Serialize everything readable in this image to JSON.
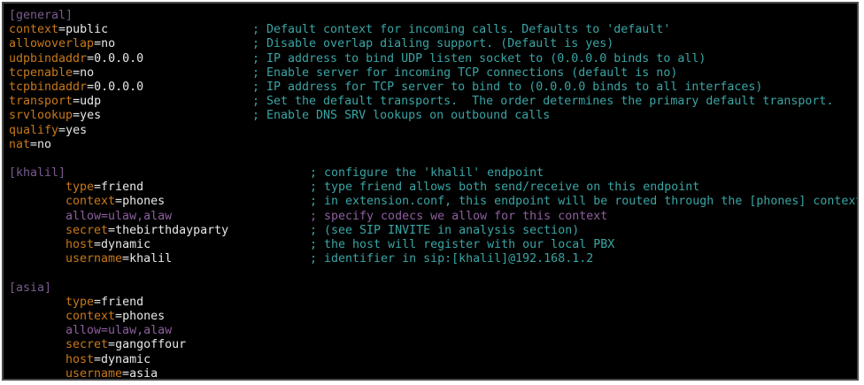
{
  "colors": {
    "background": "#000000",
    "section": "#7a5c8e",
    "key": "#c8781a",
    "value": "#e8e8e8",
    "comment": "#3aa5a5",
    "allow_line": "#8e5ea0"
  },
  "lines": [
    {
      "kind": "section",
      "text": "[general]"
    },
    {
      "kind": "kv",
      "key": "context",
      "eq": "=",
      "value": "public",
      "comment": "; Default context for incoming calls. Defaults to 'default'"
    },
    {
      "kind": "kv",
      "key": "allowoverlap",
      "eq": "=",
      "value": "no",
      "comment": "; Disable overlap dialing support. (Default is yes)"
    },
    {
      "kind": "kv",
      "key": "udpbindaddr",
      "eq": "=",
      "value": "0.0.0.0",
      "comment": "; IP address to bind UDP listen socket to (0.0.0.0 binds to all)"
    },
    {
      "kind": "kv",
      "key": "tcpenable",
      "eq": "=",
      "value": "no",
      "comment": "; Enable server for incoming TCP connections (default is no)"
    },
    {
      "kind": "kv",
      "key": "tcpbindaddr",
      "eq": "=",
      "value": "0.0.0.0",
      "comment": "; IP address for TCP server to bind to (0.0.0.0 binds to all interfaces)"
    },
    {
      "kind": "kv",
      "key": "transport",
      "eq": "=",
      "value": "udp",
      "comment": "; Set the default transports.  The order determines the primary default transport."
    },
    {
      "kind": "kv",
      "key": "srvlookup",
      "eq": "=",
      "value": "yes",
      "comment": "; Enable DNS SRV lookups on outbound calls"
    },
    {
      "kind": "kv",
      "key": "qualify",
      "eq": "=",
      "value": "yes",
      "comment": ""
    },
    {
      "kind": "kv",
      "key": "nat",
      "eq": "=",
      "value": "no",
      "comment": ""
    },
    {
      "kind": "blank"
    },
    {
      "kind": "section",
      "text": "[khalil]",
      "comment": "; configure the 'khalil' endpoint"
    },
    {
      "kind": "kv",
      "indent": true,
      "key": "type",
      "eq": "=",
      "value": "friend",
      "comment": "; type friend allows both send/receive on this endpoint"
    },
    {
      "kind": "kv",
      "indent": true,
      "key": "context",
      "eq": "=",
      "value": "phones",
      "comment": "; in extension.conf, this endpoint will be routed through the [phones] context"
    },
    {
      "kind": "kv",
      "indent": true,
      "purple": true,
      "key": "allow",
      "eq": "=",
      "value": "ulaw,alaw",
      "comment": "; specify codecs we allow for this context"
    },
    {
      "kind": "kv",
      "indent": true,
      "key": "secret",
      "eq": "=",
      "value": "thebirthdayparty",
      "comment": "; (see SIP INVITE in analysis section)"
    },
    {
      "kind": "kv",
      "indent": true,
      "key": "host",
      "eq": "=",
      "value": "dynamic",
      "comment": "; the host will register with our local PBX"
    },
    {
      "kind": "kv",
      "indent": true,
      "key": "username",
      "eq": "=",
      "value": "khalil",
      "comment": "; identifier in sip:[khalil]@192.168.1.2"
    },
    {
      "kind": "blank"
    },
    {
      "kind": "section",
      "text": "[asia]"
    },
    {
      "kind": "kv",
      "indent": true,
      "key": "type",
      "eq": "=",
      "value": "friend",
      "comment": ""
    },
    {
      "kind": "kv",
      "indent": true,
      "key": "context",
      "eq": "=",
      "value": "phones",
      "comment": ""
    },
    {
      "kind": "kv",
      "indent": true,
      "purple": true,
      "key": "allow",
      "eq": "=",
      "value": "ulaw,alaw",
      "comment": ""
    },
    {
      "kind": "kv",
      "indent": true,
      "key": "secret",
      "eq": "=",
      "value": "gangoffour",
      "comment": ""
    },
    {
      "kind": "kv",
      "indent": true,
      "key": "host",
      "eq": "=",
      "value": "dynamic",
      "comment": ""
    },
    {
      "kind": "kv",
      "indent": true,
      "key": "username",
      "eq": "=",
      "value": "asia",
      "comment": ""
    }
  ]
}
